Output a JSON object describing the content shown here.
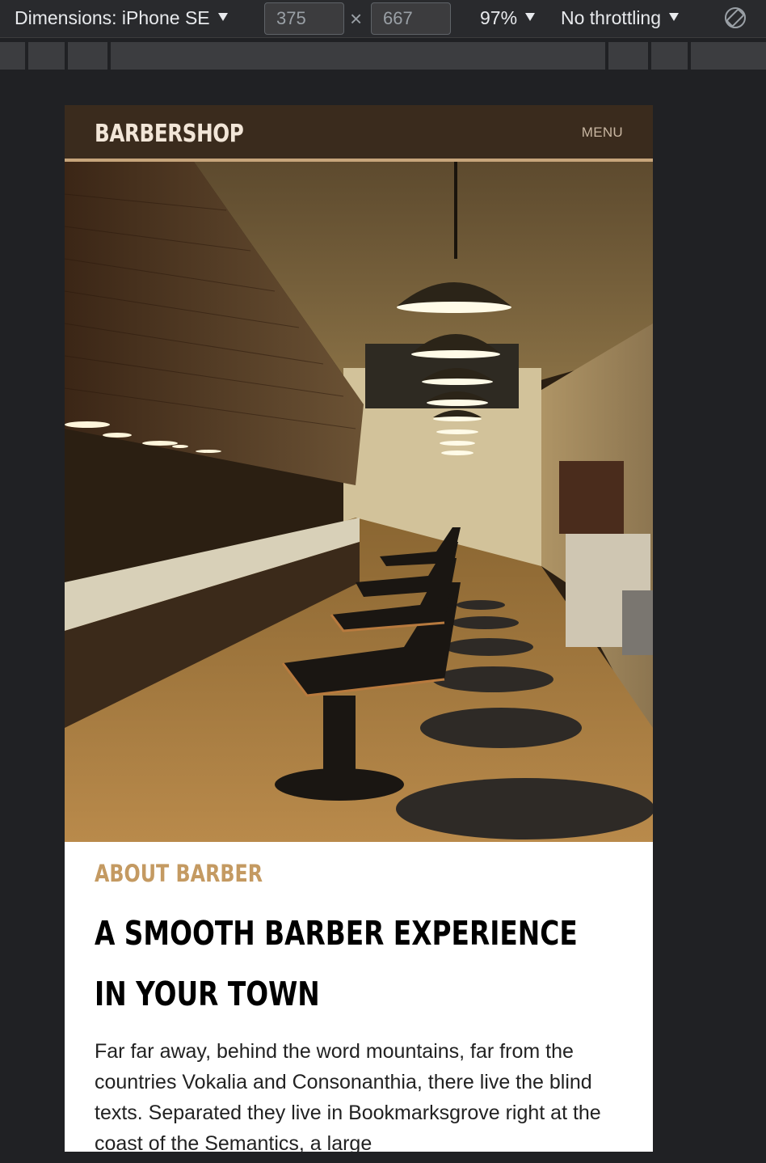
{
  "devtools": {
    "dimensions_label": "Dimensions: iPhone SE",
    "width_value": "375",
    "height_value": "667",
    "zoom": "97%",
    "throttling": "No throttling",
    "rotate_icon": "rotate-icon"
  },
  "site": {
    "brand": "BARBERSHOP",
    "menu_label": "MENU",
    "hero_alt": "barbershop interior",
    "colors": {
      "header_bg": "#3a2b1d",
      "accent": "#c49a62"
    }
  },
  "about": {
    "kicker": "ABOUT BARBER",
    "title": "A SMOOTH BARBER EXPERIENCE IN YOUR TOWN",
    "body": "Far far away, behind the word mountains, far from the countries Vokalia and Consonanthia, there live the blind texts. Separated they live in Bookmarksgrove right at the coast of the Semantics, a large"
  }
}
